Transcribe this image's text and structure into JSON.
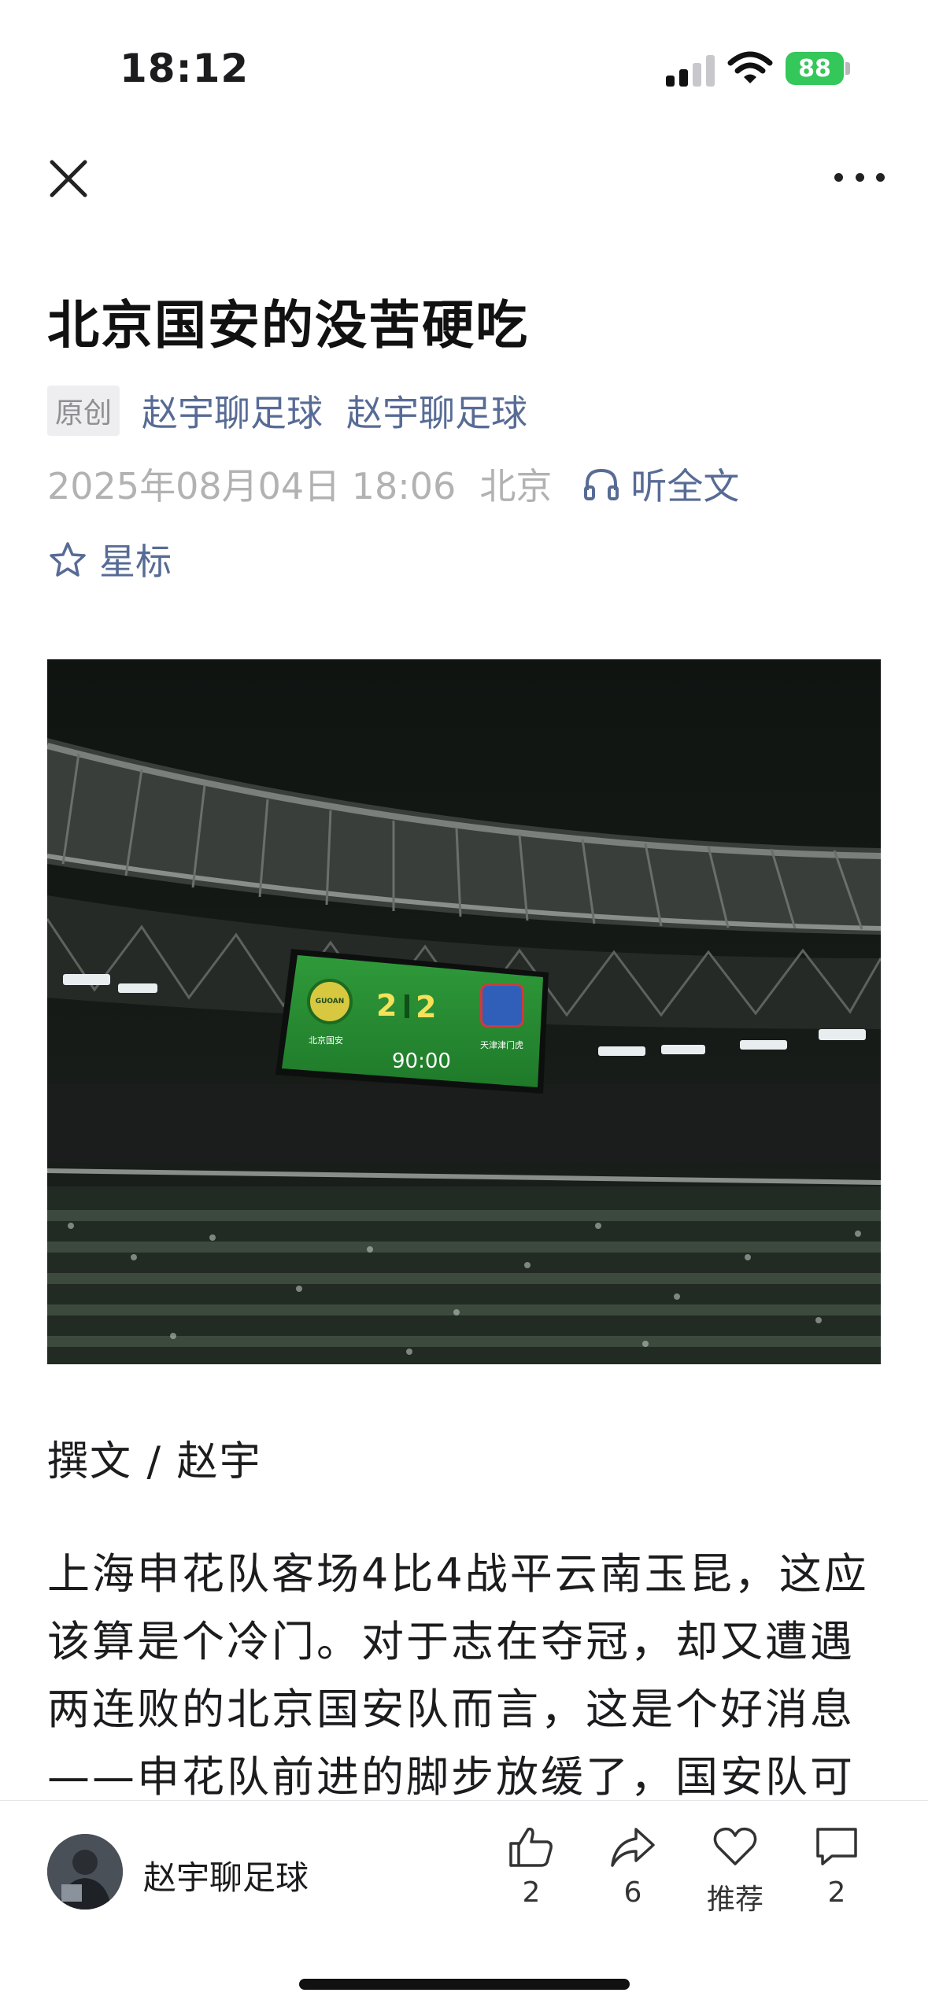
{
  "status_bar": {
    "time": "18:12",
    "battery": "88",
    "icons": [
      "signal-icon",
      "wifi-icon",
      "battery-icon"
    ]
  },
  "nav": {
    "icons": [
      "close-icon",
      "more-icon"
    ]
  },
  "article": {
    "title": "北京国安的没苦硬吃",
    "original_badge": "原创",
    "author_1": "赵宇聊足球",
    "author_2": "赵宇聊足球",
    "date": "2025年08月04日 18:06",
    "location": "北京",
    "listen_label": "听全文",
    "star_label": "星标",
    "byline": "撰文 / 赵宇",
    "paragraph_lines": [
      "上海申花队客场4比4战平云南玉昆，这应",
      "该算是个冷门。对于志在夺冠，却又遭遇",
      "两连败的北京国安队而言，这是个好消息",
      "——申花队前进的脚步放缓了，国安队可"
    ]
  },
  "scoreboard": {
    "home_badge": "GUOAN",
    "home_team": "北京国安",
    "away_team": "天津津门虎",
    "home_score": "2",
    "away_score": "2",
    "clock": "90:00"
  },
  "bottom_bar": {
    "account_name": "赵宇聊足球",
    "like_count": "2",
    "share_count": "6",
    "recommend_label": "推荐",
    "comment_count": "2"
  },
  "colors": {
    "link": "#576b95",
    "battery": "#34c759",
    "muted": "#b2b2b2"
  }
}
